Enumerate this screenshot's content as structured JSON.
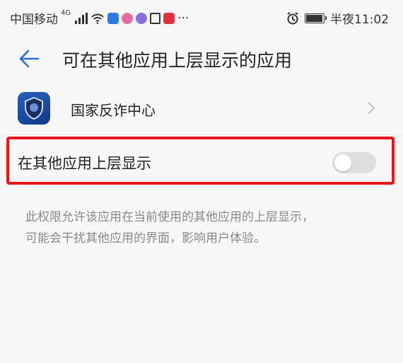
{
  "status_bar": {
    "carrier": "中国移动",
    "network": "4G",
    "more": "···",
    "time": "半夜11:02"
  },
  "header": {
    "title": "可在其他应用上层显示的应用"
  },
  "app_row": {
    "name": "国家反诈中心"
  },
  "toggle_row": {
    "label": "在其他应用上层显示",
    "enabled": false
  },
  "description": {
    "line1": "此权限允许该应用在当前使用的其他应用的上层显示，",
    "line2": "可能会干扰其他应用的界面，影响用户体验。"
  },
  "colors": {
    "highlight_border": "#e8141b",
    "back_arrow": "#2b6fd6",
    "switch_off": "#dedede",
    "description_text": "#888888"
  }
}
